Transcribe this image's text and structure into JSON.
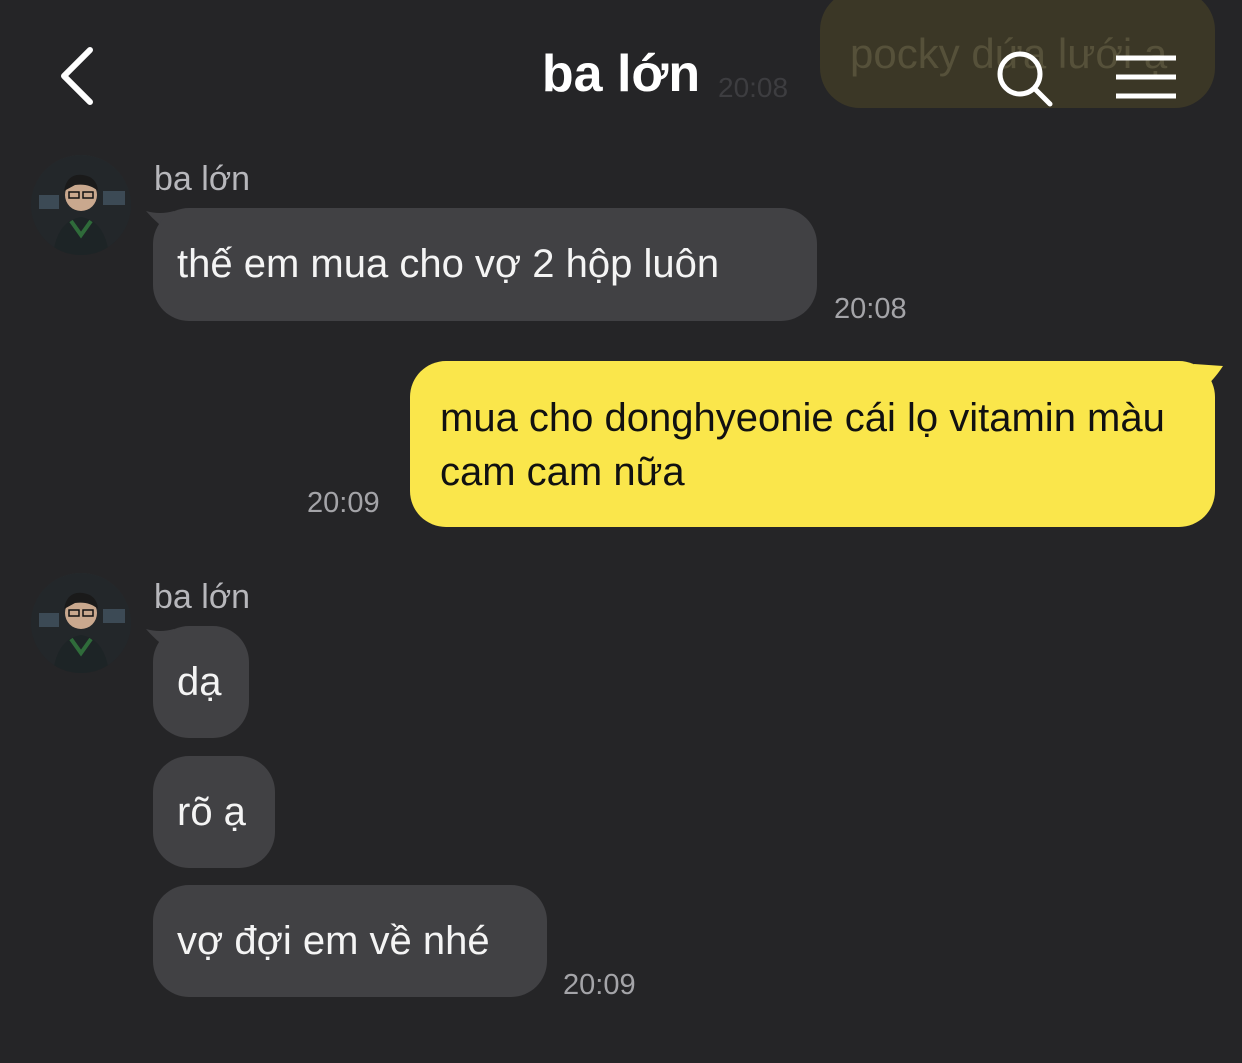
{
  "background_peek": {
    "message": "pocky dứa lưới ạ",
    "time": "20:08"
  },
  "header": {
    "title": "ba lớn",
    "back_icon": "chevron-left-icon",
    "search_icon": "search-icon",
    "menu_icon": "hamburger-menu-icon"
  },
  "messages": [
    {
      "sender": "ba lớn",
      "direction": "incoming",
      "bubbles": [
        "thế em mua cho vợ 2 hộp luôn"
      ],
      "time": "20:08"
    },
    {
      "direction": "outgoing",
      "bubbles": [
        "mua cho donghyeonie cái lọ vitamin màu cam cam nữa"
      ],
      "time": "20:09"
    },
    {
      "sender": "ba lớn",
      "direction": "incoming",
      "bubbles": [
        "dạ",
        "rõ ạ",
        "vợ đợi em về nhé"
      ],
      "time": "20:09"
    }
  ],
  "colors": {
    "background": "#252527",
    "incoming_bubble": "#414144",
    "outgoing_bubble": "#fae64b",
    "timestamp": "#a4a4a8"
  }
}
